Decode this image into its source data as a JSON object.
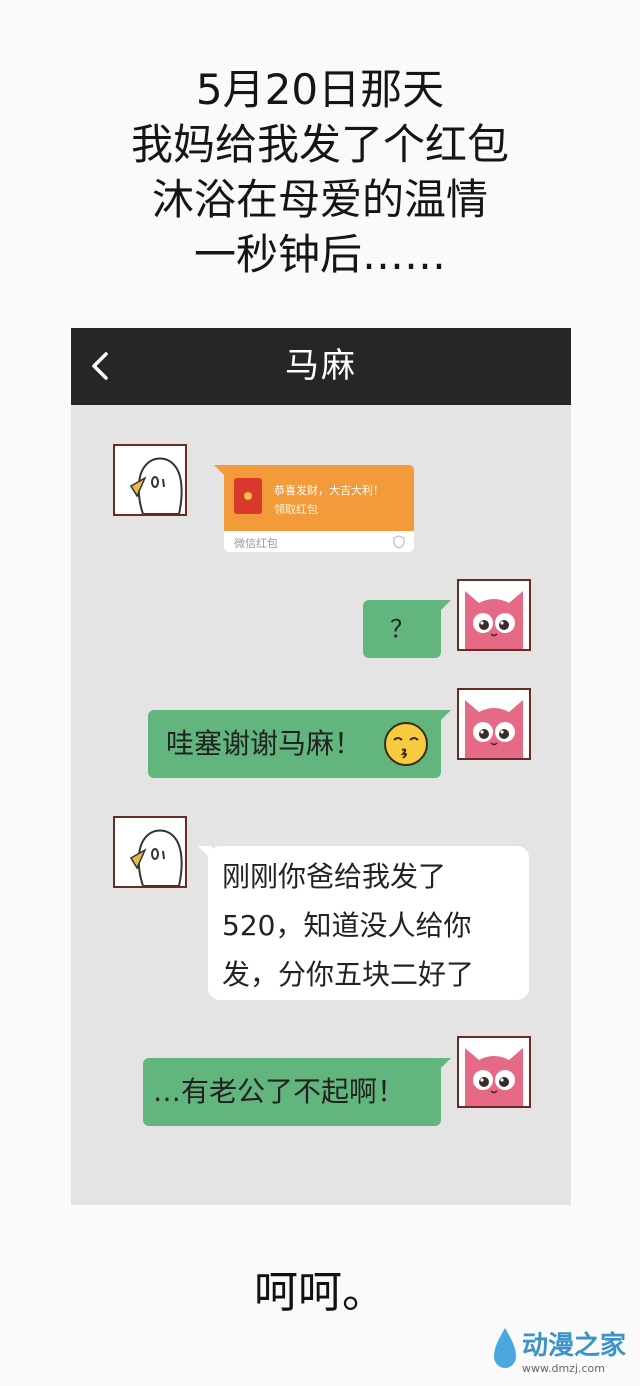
{
  "caption": {
    "lines": [
      "5月20日那天",
      "我妈给我发了个红包",
      "沐浴在母爱的温情",
      "一秒钟后……"
    ]
  },
  "chat": {
    "title": "马麻",
    "back_icon": "chevron-left-icon",
    "red_packet": {
      "greeting": "恭喜发财，大吉大利！",
      "action": "领取红包",
      "label": "微信红包"
    },
    "messages": [
      {
        "from": "me",
        "text": "？"
      },
      {
        "from": "me",
        "text": "哇塞谢谢马麻！",
        "emoji": "kissing-face-icon"
      },
      {
        "from": "mom",
        "lines": [
          "刚刚你爸给我发了",
          "520，知道没人给你",
          "发，分你五块二好了"
        ]
      },
      {
        "from": "me",
        "text": "…有老公了不起啊！"
      }
    ]
  },
  "ending": "呵呵。",
  "watermark": {
    "name": "动漫之家",
    "url": "www.dmzj.com"
  },
  "colors": {
    "topbar": "#252725",
    "chat_bg": "#e4e4e4",
    "green_bubble": "#62b67d",
    "red_packet": "#f39a3a"
  }
}
